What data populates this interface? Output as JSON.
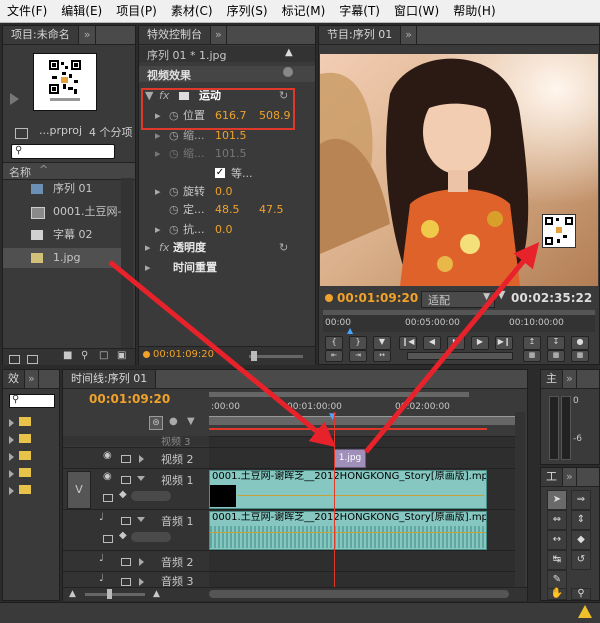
{
  "menu": [
    "文件(F)",
    "编辑(E)",
    "项目(P)",
    "素材(C)",
    "序列(S)",
    "标记(M)",
    "字幕(T)",
    "窗口(W)",
    "帮助(H)"
  ],
  "project": {
    "tab_label": "项目:未命名",
    "file_name": "...prproj",
    "item_count": "4 个分项",
    "column_header": "名称",
    "items": [
      "序列 01",
      "0001.土豆网-",
      "字幕 02",
      "1.jpg"
    ]
  },
  "effects": {
    "tab_label": "特效控制台",
    "subtitle": "序列 01 * 1.jpg",
    "section_label": "视频效果",
    "motion_label": "运动",
    "position_label": "位置",
    "position_x": "616.7",
    "position_y": "508.9",
    "scale_label": "缩...",
    "scale_value": "101.5",
    "scale_w_label": "缩...",
    "scale_w_value": "101.5",
    "uniform_label": "等...",
    "rotation_label": "旋转",
    "rotation_value": "0.0",
    "anchor_label": "定...",
    "anchor_x": "48.5",
    "anchor_y": "47.5",
    "anti_flicker_label": "抗...",
    "anti_flicker_value": "0.0",
    "opacity_label": "透明度",
    "time_remap_label": "时间重置",
    "timecode": "00:01:09:20"
  },
  "program": {
    "tab_label": "节目:序列 01",
    "timecode": "00:01:09:20",
    "fit_label": "适配",
    "duration": "00:02:35:22",
    "ruler": [
      "00:00",
      "00:05:00:00",
      "00:10:00:00"
    ]
  },
  "effects_browser": {
    "tab_label": "效"
  },
  "timeline": {
    "tab_label": "时间线:序列 01",
    "timecode": "00:01:09:20",
    "ruler": [
      ":00:00",
      "00:01:00:00",
      "00:02:00:00"
    ],
    "tracks": {
      "video3": "视频 3",
      "video2": "视频 2",
      "video1": "视频 1",
      "audio1": "音频 1",
      "audio2": "音频 2",
      "audio3": "音频 3"
    },
    "track_target": "V",
    "image_clip": "1.jpg",
    "video_clip": "0001.土豆网-谢晖芝__2012HONGKONG_Story[原画版].mp",
    "audio_clip": "0001.土豆网-谢晖芝__2012HONGKONG_Story[原画版].mp"
  },
  "audio_meter": {
    "tab_label": "主",
    "db0": "0",
    "db6": "-6"
  },
  "tools": {
    "tab_label": "工"
  },
  "colors": {
    "accent": "#f0a22a",
    "highlight_box": "#e0392b",
    "clip": "#86c8c1"
  }
}
